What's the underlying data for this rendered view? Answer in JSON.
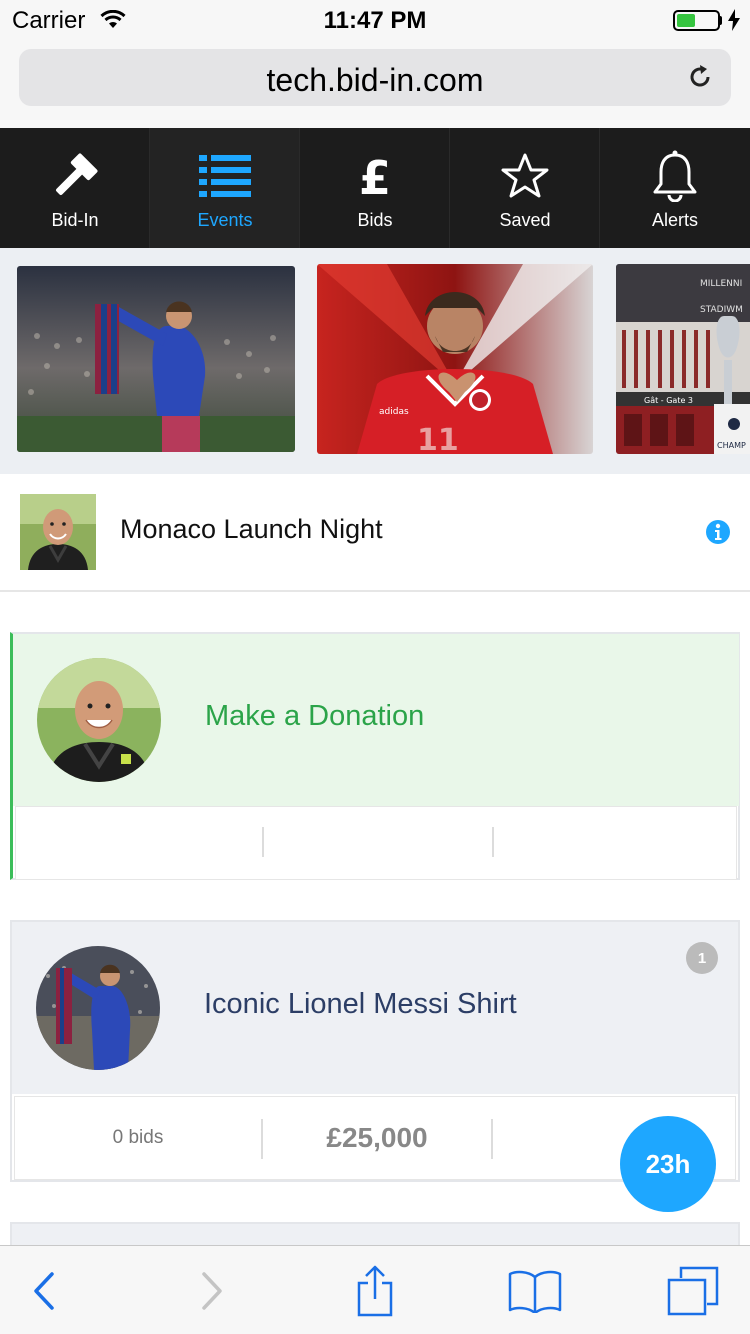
{
  "status_bar": {
    "carrier": "Carrier",
    "time": "11:47 PM",
    "battery_level": 0.45,
    "wifi_icon": "wifi-icon",
    "charging_icon": "bolt-icon"
  },
  "browser": {
    "url": "tech.bid-in.com",
    "reload_icon": "reload-icon"
  },
  "nav": {
    "items": [
      {
        "label": "Bid-In",
        "icon": "gavel-icon",
        "active": false
      },
      {
        "label": "Events",
        "icon": "list-icon",
        "active": true
      },
      {
        "label": "Bids",
        "icon": "pound-icon",
        "active": false
      },
      {
        "label": "Saved",
        "icon": "star-icon",
        "active": false
      },
      {
        "label": "Alerts",
        "icon": "bell-icon",
        "active": false
      }
    ],
    "active_color": "#1ea7ff"
  },
  "carousel": {
    "slides": [
      {
        "name": "messi-shirt-photo"
      },
      {
        "name": "wales-player-heart-photo"
      },
      {
        "name": "stadium-trophy-photo"
      }
    ],
    "stadium_text": {
      "top": "MILLENNI",
      "mid": "STADIWM",
      "gate": "Gât - Gate 3",
      "logo": "CHAMP"
    }
  },
  "event": {
    "title": "Monaco Launch Night",
    "info_icon": "info-icon"
  },
  "donation_card": {
    "title": "Make a Donation",
    "accent": "#3cbd5a"
  },
  "lot_card": {
    "title": "Iconic Lionel Messi Shirt",
    "bids": "0 bids",
    "price": "£25,000",
    "badge": "1",
    "timer": "23h"
  },
  "toolbar": {
    "back_icon": "back-chevron-icon",
    "forward_icon": "forward-chevron-icon",
    "share_icon": "share-icon",
    "bookmarks_icon": "book-icon",
    "tabs_icon": "tabs-icon",
    "tint": "#1a6fe6"
  }
}
